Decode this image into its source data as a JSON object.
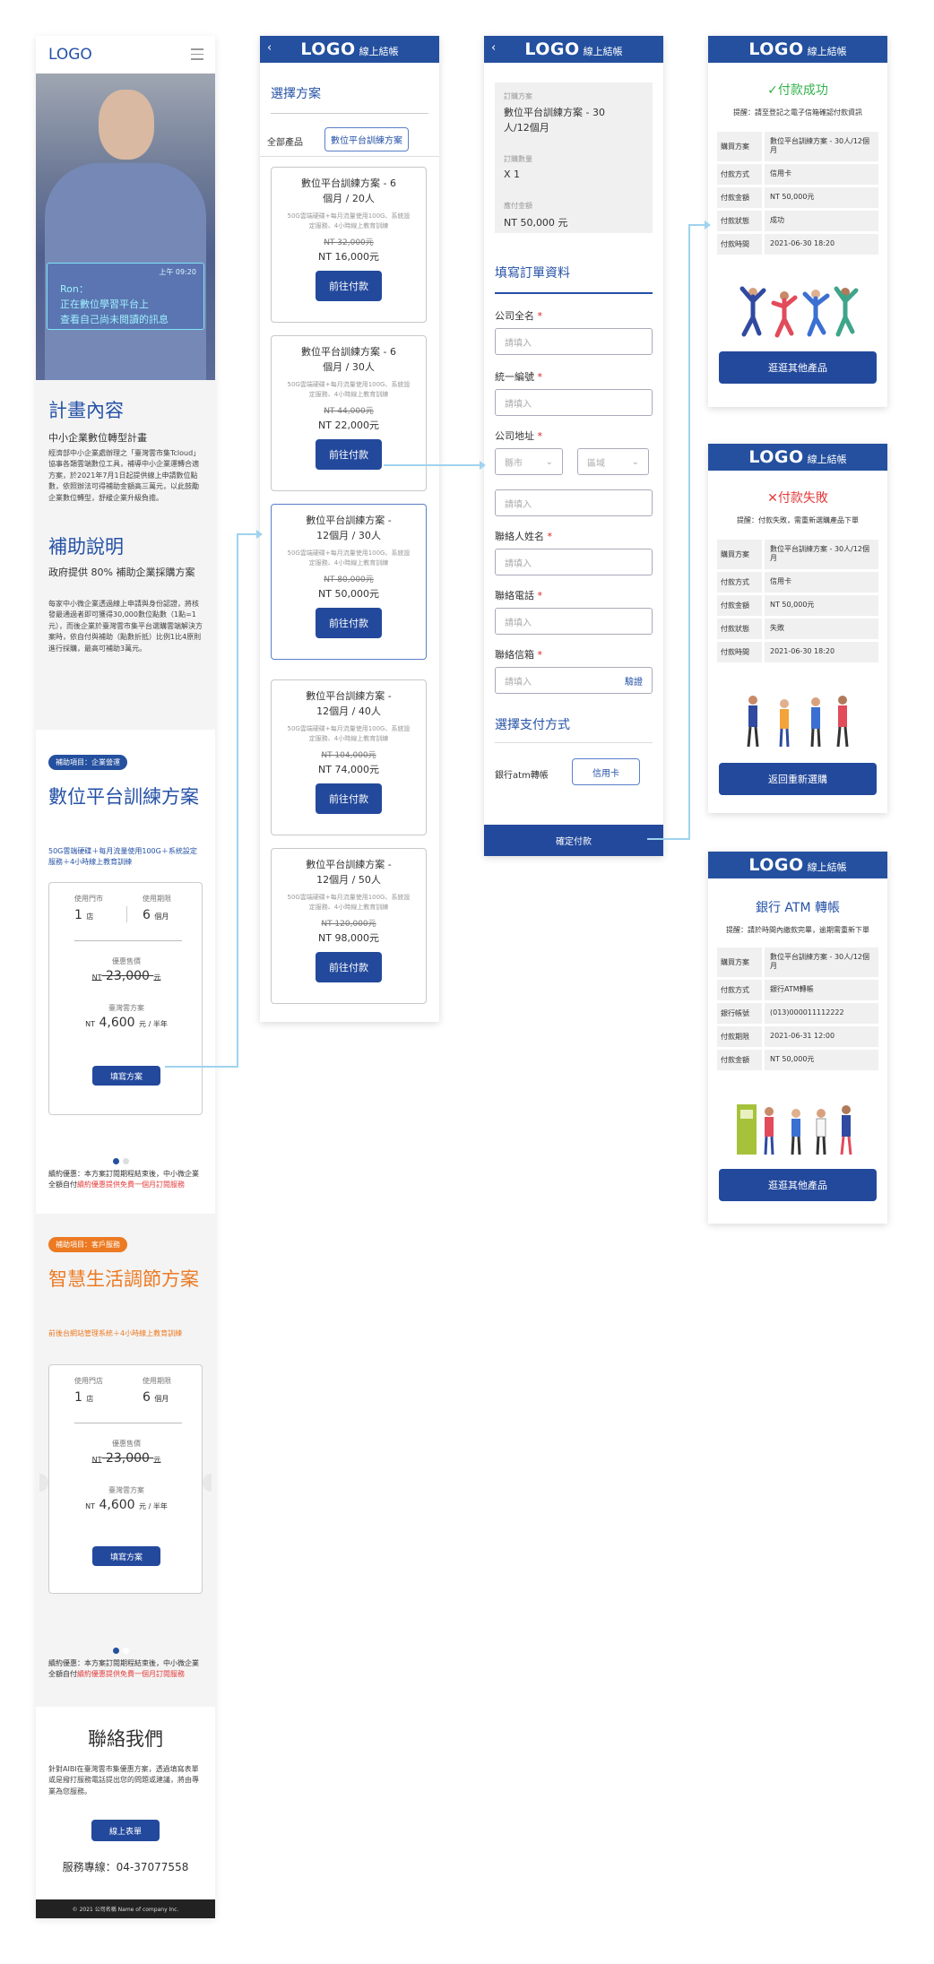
{
  "colors": {
    "primary": "#24509f",
    "orange": "#ec7a22",
    "red": "#e33b3b",
    "green": "#33b24b",
    "connector": "#9fd3ef"
  },
  "landing": {
    "logo": "LOGO",
    "menu_icon": "hamburger-icon",
    "notification": {
      "time": "上午 09:20",
      "line1": "Ron：",
      "line2": "正在數位學習平台上",
      "line3": "查看自己尚未閱讀的訊息"
    },
    "plan_title": "計畫內容",
    "plan_subtitle": "中小企業數位轉型計畫",
    "plan_body": "經濟部中小企業處辦理之「臺灣雲市集Tcloud」協事各類雲端數位工具，補導中小企業運轉合適方案，於2021年7月1日起提供線上申請數位點數，依照辦法可得補助金額高三萬元，以此鼓勵企業數位轉型，舒緩企業升級負擔。",
    "subsidy_title": "補助說明",
    "subsidy_subtitle": "政府提供 80% 補助企業採購方案",
    "subsidy_body": "每家中小微企業透過線上申請與身份認證，將核發最通過者即可獲得30,000數位點數（1點=1元），而後企業於臺灣雲市集平台選購雲端解決方案時，依自付與補助（點數折抵）比例1比4原則進行採購，最高可補助3萬元。",
    "card1": {
      "badge": "補助項目：企業營運",
      "title": "數位平台訓練方案",
      "features": "50G雲端硬碟＋每月流量使用100G＋系統設定服務＋4小時線上教育訓練",
      "stores_label": "使用門市",
      "stores_value": "1",
      "stores_unit": "店",
      "period_label": "使用期限",
      "period_value": "6",
      "period_unit": "個月",
      "promo_label": "優惠售價",
      "promo_price": "23,000",
      "currency": "NT",
      "unit_yuan": "元",
      "cloud_label": "臺灣雲方案",
      "cloud_price": "4,600",
      "cloud_unit": "元 / 半年",
      "button": "填寫方案",
      "note_plain": "續約優惠：本方案訂閱期程結束後，中小微企業全額自付",
      "note_red": "續約優惠提供免費一個月訂閱服務"
    },
    "card2": {
      "badge": "補助項目：客戶服務",
      "title": "智慧生活調節方案",
      "features": "前後台網站管理系統＋4小時線上教育訓練",
      "stores_label": "使用門店",
      "stores_value": "1",
      "stores_unit": "店",
      "period_label": "使用期限",
      "period_value": "6",
      "period_unit": "個月",
      "promo_label": "優惠售價",
      "promo_price": "23,000",
      "currency": "NT",
      "unit_yuan": "元",
      "cloud_label": "臺灣雲方案",
      "cloud_price": "4,600",
      "cloud_unit": "元 / 半年",
      "button": "填寫方案",
      "note_plain": "續約優惠：本方案訂閱期程結束後，中小微企業全額自付",
      "note_red": "續約優惠提供免費一個月訂閱服務"
    },
    "contact": {
      "title": "聯絡我們",
      "body": "針對AIBI在臺灣雲市集優惠方案，透過填寫表單或是撥打服務電話提出您的問題或建議，將由專業為您服務。",
      "button": "線上表單",
      "hotline": "服務專線：04-37077558"
    },
    "footer": "© 2021 公司名稱 Name of company Inc."
  },
  "plans_screen": {
    "logo": "LOGO",
    "sub": "線上結帳",
    "title": "選擇方案",
    "tabs": [
      "全部產品",
      "數位平台訓練方案"
    ],
    "plans": [
      {
        "name": "數位平台訓練方案 - 6個月 / 20人",
        "desc": "50G雲端硬碟+每月流量使用100G、系統設定服務、4小時線上教育訓練",
        "old": "NT 32,000元",
        "price": "NT 16,000元",
        "button": "前往付款"
      },
      {
        "name": "數位平台訓練方案 - 6個月 / 30人",
        "desc": "50G雲端硬碟+每月流量使用100G、系統設定服務、4小時線上教育訓練",
        "old": "NT 44,000元",
        "price": "NT 22,000元",
        "button": "前往付款"
      },
      {
        "name": "數位平台訓練方案 - 12個月 / 30人",
        "desc": "50G雲端硬碟+每月流量使用100G、系統設定服務、4小時線上教育訓練",
        "old": "NT 80,000元",
        "price": "NT 50,000元",
        "button": "前往付款"
      },
      {
        "name": "數位平台訓練方案 - 12個月 / 40人",
        "desc": "50G雲端硬碟+每月流量使用100G、系統設定服務、4小時線上教育訓練",
        "old": "NT 104,000元",
        "price": "NT 74,000元",
        "button": "前往付款"
      },
      {
        "name": "數位平台訓練方案 - 12個月 / 50人",
        "desc": "50G雲端硬碟+每月流量使用100G、系統設定服務、4小時線上教育訓練",
        "old": "NT 120,000元",
        "price": "NT 98,000元",
        "button": "前往付款"
      }
    ]
  },
  "order_screen": {
    "logo": "LOGO",
    "sub": "線上結帳",
    "summary": {
      "plan_label": "訂購方案",
      "plan_value": "數位平台訓練方案 - 30人/12個月",
      "qty_label": "訂購數量",
      "qty_value": "X 1",
      "total_label": "應付金額",
      "total_value": "NT  50,000 元"
    },
    "form_title": "填寫訂單資料",
    "company_label": "公司全名",
    "placeholder": "請填入",
    "tax_label": "統一編號",
    "address_label": "公司地址",
    "city": "縣市",
    "district": "區域",
    "contact_label": "聯絡人姓名",
    "phone_label": "聯絡電話",
    "email_label": "聯絡信箱",
    "verify": "驗證",
    "pay_title": "選擇支付方式",
    "pay_atm": "銀行atm轉帳",
    "pay_card": "信用卡",
    "submit": "確定付款"
  },
  "success_screen": {
    "logo": "LOGO",
    "sub": "線上結帳",
    "title": "付款成功",
    "note": "提醒：請至登記之電子信箱確認付款資訊",
    "rows": [
      {
        "k": "購買方案",
        "v": "數位平台訓練方案 - 30人/12個月"
      },
      {
        "k": "付款方式",
        "v": "信用卡"
      },
      {
        "k": "付款金額",
        "v": "NT 50,000元"
      },
      {
        "k": "付款狀態",
        "v": "成功"
      },
      {
        "k": "付款時間",
        "v": "2021-06-30 18:20"
      }
    ],
    "button": "逛逛其他產品"
  },
  "fail_screen": {
    "logo": "LOGO",
    "sub": "線上結帳",
    "title": "付款失敗",
    "note": "提醒：付款失敗，需重新選購產品下單",
    "rows": [
      {
        "k": "購買方案",
        "v": "數位平台訓練方案 - 30人/12個月"
      },
      {
        "k": "付款方式",
        "v": "信用卡"
      },
      {
        "k": "付款金額",
        "v": "NT 50,000元"
      },
      {
        "k": "付款狀態",
        "v": "失敗"
      },
      {
        "k": "付款時間",
        "v": "2021-06-30 18:20"
      }
    ],
    "button": "返回重新選購"
  },
  "atm_screen": {
    "logo": "LOGO",
    "sub": "線上結帳",
    "title": "銀行 ATM 轉帳",
    "note": "提醒：請於時間內繳款完畢，逾期需重新下單",
    "rows": [
      {
        "k": "購買方案",
        "v": "數位平台訓練方案 - 30人/12個月"
      },
      {
        "k": "付款方式",
        "v": "銀行ATM轉帳"
      },
      {
        "k": "銀行帳號",
        "v": "(013)000011112222"
      },
      {
        "k": "付款期限",
        "v": "2021-06-31 12:00"
      },
      {
        "k": "付款金額",
        "v": "NT 50,000元"
      }
    ],
    "button": "逛逛其他產品"
  }
}
